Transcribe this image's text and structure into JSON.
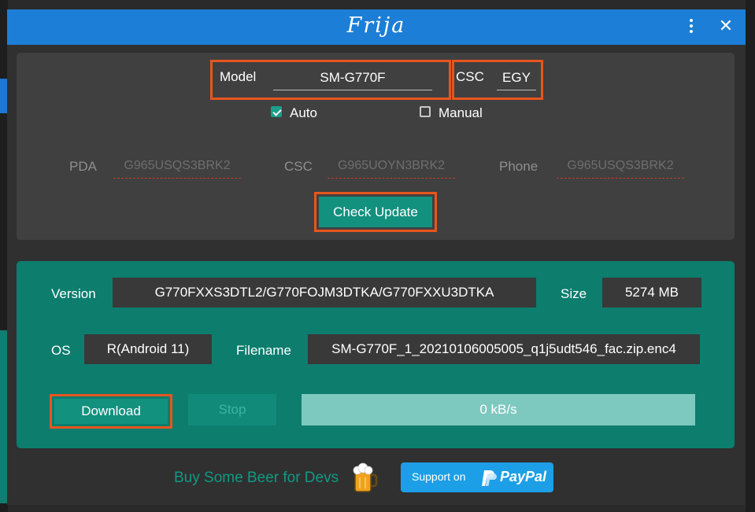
{
  "window": {
    "title": "Frija"
  },
  "search": {
    "model_label": "Model",
    "model_value": "SM-G770F",
    "csc_label": "CSC",
    "csc_value": "EGY",
    "auto_label": "Auto",
    "auto_checked": true,
    "manual_label": "Manual",
    "manual_checked": false,
    "pda_label": "PDA",
    "pda_placeholder": "G965USQS3BRK2",
    "csc2_label": "CSC",
    "csc2_placeholder": "G965UOYN3BRK2",
    "phone_label": "Phone",
    "phone_placeholder": "G965USQS3BRK2",
    "check_update_label": "Check Update"
  },
  "result": {
    "version_label": "Version",
    "version_value": "G770FXXS3DTL2/G770FOJM3DTKA/G770FXXU3DTKA",
    "size_label": "Size",
    "size_value": "5274 MB",
    "os_label": "OS",
    "os_value": "R(Android 11)",
    "filename_label": "Filename",
    "filename_value": "SM-G770F_1_20210106005005_q1j5udt546_fac.zip.enc4",
    "download_label": "Download",
    "stop_label": "Stop",
    "progress_text": "0 kB/s",
    "progress_value": 0
  },
  "footer": {
    "beer_text": "Buy Some Beer for Devs",
    "beer_icon": "beer-mug-icon",
    "paypal_support": "Support on",
    "paypal_brand": "PayPal"
  },
  "colors": {
    "titlebar": "#1c7ed6",
    "accent": "#13917f",
    "highlight": "#e8551f",
    "panel_teal": "#0d7d6e"
  }
}
